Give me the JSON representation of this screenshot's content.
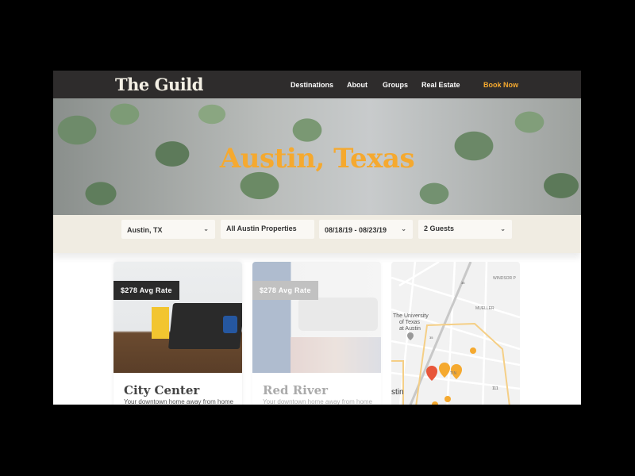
{
  "nav": {
    "logo": "The Guild",
    "links": [
      "Destinations",
      "About",
      "Groups",
      "Real Estate"
    ],
    "cta": "Book Now",
    "cta_color": "#f5a92f"
  },
  "hero": {
    "title": "Austin, Texas"
  },
  "filters": {
    "location": "Austin, TX",
    "property": "All Austin Properties",
    "dates": "08/18/19 - 08/23/19",
    "guests": "2 Guests"
  },
  "cards": [
    {
      "badge": "$278 Avg Rate",
      "title": "City Center",
      "subtitle": "Your downtown home away from home"
    },
    {
      "badge": "$278 Avg Rate",
      "title": "Red River",
      "subtitle": "Your downtown home away from home"
    }
  ],
  "map": {
    "labels": [
      "WINDSOR P",
      "MUELLER",
      "The University",
      "of Texas",
      "at Austin",
      "TIN",
      "stin",
      "35",
      "35",
      "111"
    ]
  }
}
